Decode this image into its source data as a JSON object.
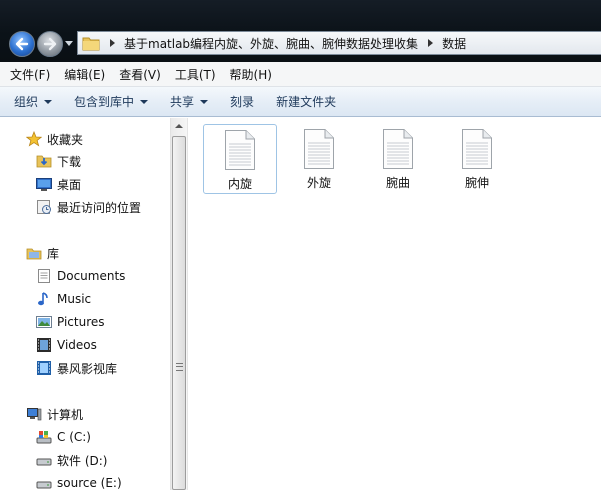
{
  "address": {
    "crumbs": [
      "基于matlab编程内旋、外旋、腕曲、腕伸数据处理收集",
      "数据"
    ]
  },
  "menu": [
    "文件(F)",
    "编辑(E)",
    "查看(V)",
    "工具(T)",
    "帮助(H)"
  ],
  "commands": [
    {
      "label": "组织",
      "dropdown": true
    },
    {
      "label": "包含到库中",
      "dropdown": true
    },
    {
      "label": "共享",
      "dropdown": true
    },
    {
      "label": "刻录",
      "dropdown": false
    },
    {
      "label": "新建文件夹",
      "dropdown": false
    }
  ],
  "nav": {
    "favorites": {
      "label": "收藏夹",
      "items": [
        "下载",
        "桌面",
        "最近访问的位置"
      ]
    },
    "libraries": {
      "label": "库",
      "items": [
        "Documents",
        "Music",
        "Pictures",
        "Videos",
        "暴风影视库"
      ]
    },
    "computer": {
      "label": "计算机",
      "items": [
        "C (C:)",
        "软件 (D:)",
        "source (E:)"
      ]
    }
  },
  "files": [
    {
      "name": "内旋",
      "selected": true
    },
    {
      "name": "外旋",
      "selected": false
    },
    {
      "name": "腕曲",
      "selected": false
    },
    {
      "name": "腕伸",
      "selected": false
    }
  ]
}
